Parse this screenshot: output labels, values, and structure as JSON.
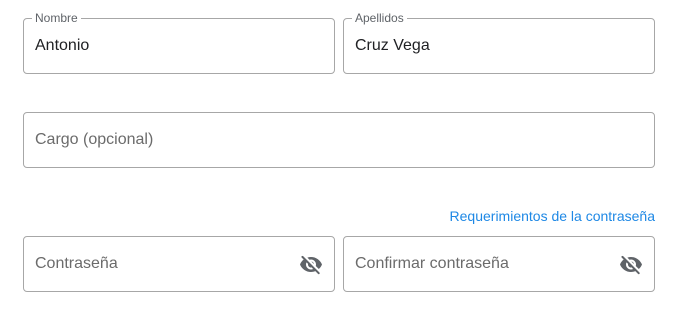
{
  "form": {
    "first_name": {
      "label": "Nombre",
      "value": "Antonio"
    },
    "last_name": {
      "label": "Apellidos",
      "value": "Cruz Vega"
    },
    "position": {
      "placeholder": "Cargo (opcional)"
    },
    "password_requirements_link": "Requerimientos de la contraseña",
    "password": {
      "placeholder": "Contraseña",
      "visibility_icon": "eye-off-icon"
    },
    "confirm_password": {
      "placeholder": "Confirmar contraseña",
      "visibility_icon": "eye-off-icon"
    }
  },
  "colors": {
    "border": "#a7a7a7",
    "label": "#5f6368",
    "text": "#202124",
    "placeholder": "#6b6b6b",
    "link": "#1e88e5",
    "icon": "#5f6368"
  }
}
